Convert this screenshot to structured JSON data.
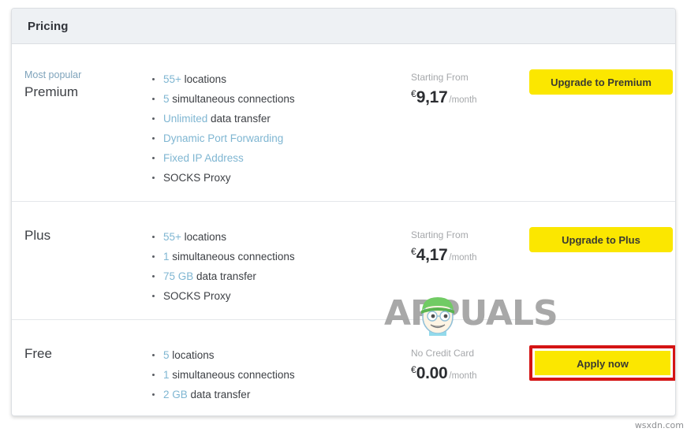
{
  "card": {
    "header_title": "Pricing"
  },
  "colors": {
    "accent_button": "#fbe700",
    "highlight_text": "#7fb6d2",
    "annotation_box": "#d41414",
    "header_bg": "#eef1f4"
  },
  "plans": [
    {
      "badge": "Most popular",
      "name": "Premium",
      "features": [
        [
          {
            "t": "55+",
            "hl": true
          },
          {
            "t": " locations",
            "hl": false
          }
        ],
        [
          {
            "t": "5",
            "hl": true
          },
          {
            "t": " simultaneous connections",
            "hl": false
          }
        ],
        [
          {
            "t": "Unlimited",
            "hl": true
          },
          {
            "t": " data transfer",
            "hl": false
          }
        ],
        [
          {
            "t": "Dynamic Port Forwarding",
            "hl": true
          }
        ],
        [
          {
            "t": "Fixed IP Address",
            "hl": true
          }
        ],
        [
          {
            "t": "SOCKS Proxy",
            "hl": false
          }
        ]
      ],
      "price_label": "Starting From",
      "currency": "€",
      "amount": "9,17",
      "period": "/month",
      "button_label": "Upgrade to Premium",
      "annotated": false
    },
    {
      "badge": "",
      "name": "Plus",
      "features": [
        [
          {
            "t": "55+",
            "hl": true
          },
          {
            "t": " locations",
            "hl": false
          }
        ],
        [
          {
            "t": "1",
            "hl": true
          },
          {
            "t": " simultaneous connections",
            "hl": false
          }
        ],
        [
          {
            "t": "75 GB",
            "hl": true
          },
          {
            "t": " data transfer",
            "hl": false
          }
        ],
        [
          {
            "t": "SOCKS Proxy",
            "hl": false
          }
        ]
      ],
      "price_label": "Starting From",
      "currency": "€",
      "amount": "4,17",
      "period": "/month",
      "button_label": "Upgrade to Plus",
      "annotated": false
    },
    {
      "badge": "",
      "name": "Free",
      "features": [
        [
          {
            "t": "5",
            "hl": true
          },
          {
            "t": " locations",
            "hl": false
          }
        ],
        [
          {
            "t": "1",
            "hl": true
          },
          {
            "t": " simultaneous connections",
            "hl": false
          }
        ],
        [
          {
            "t": "2 GB",
            "hl": true
          },
          {
            "t": " data transfer",
            "hl": false
          }
        ]
      ],
      "price_label": "No Credit Card",
      "currency": "€",
      "amount": "0.00",
      "period": "/month",
      "button_label": "Apply now",
      "annotated": true
    }
  ],
  "watermarks": {
    "brand": "APPUALS",
    "corner": "wsxdn.com"
  }
}
